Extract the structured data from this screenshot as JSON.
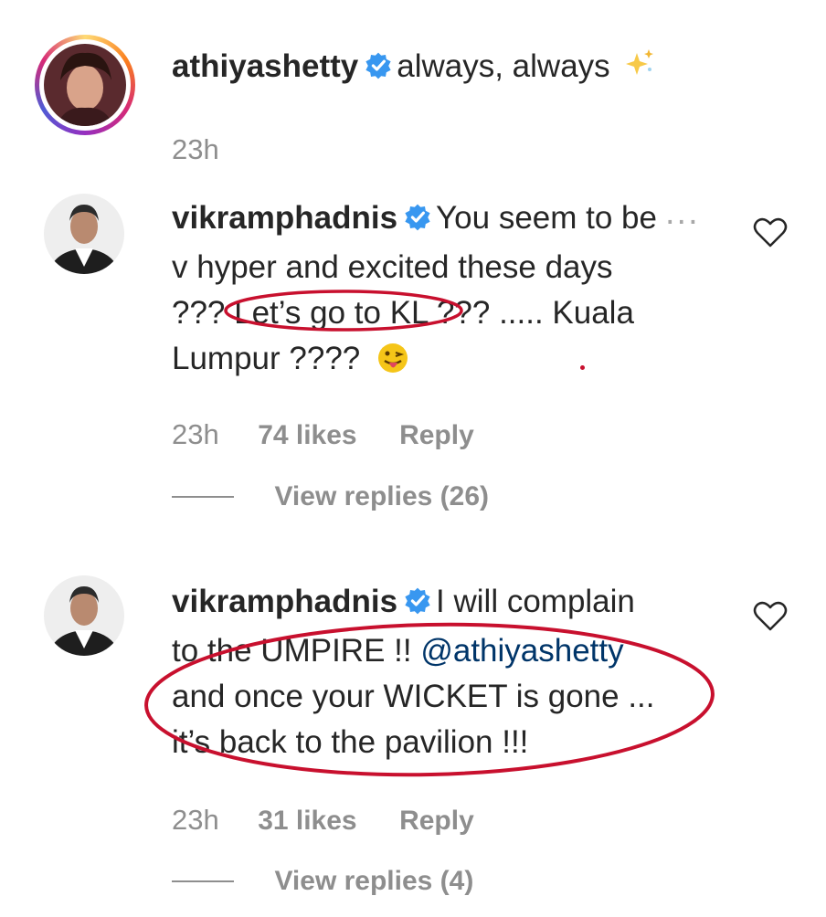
{
  "comments": [
    {
      "username": "athiyashetty",
      "text": "always, always",
      "time": "23h"
    },
    {
      "username": "vikramphadnis",
      "lines": [
        "You seem to be",
        "v hyper and excited these days",
        "??? Let’s go to KL ??? ..... Kuala",
        "Lumpur ????"
      ],
      "more": "...",
      "time": "23h",
      "likes": "74 likes",
      "reply": "Reply",
      "view_replies": "View replies (26)"
    },
    {
      "username": "vikramphadnis",
      "lines": [
        "I will complain",
        "to the UMPIRE !!",
        "and once your WICKET is gone ...",
        "it’s back to the pavilion !!!"
      ],
      "mention": "@athiyashetty",
      "time": "23h",
      "likes": "31 likes",
      "reply": "Reply",
      "view_replies": "View replies (4)"
    }
  ],
  "colors": {
    "verified": "#3897f0",
    "annotation": "#c8102e",
    "muted": "#8e8e8e",
    "mention": "#003569"
  },
  "icons": [
    "verified-badge-icon",
    "sparkles-icon",
    "tongue-out-emoji-icon",
    "heart-icon"
  ]
}
